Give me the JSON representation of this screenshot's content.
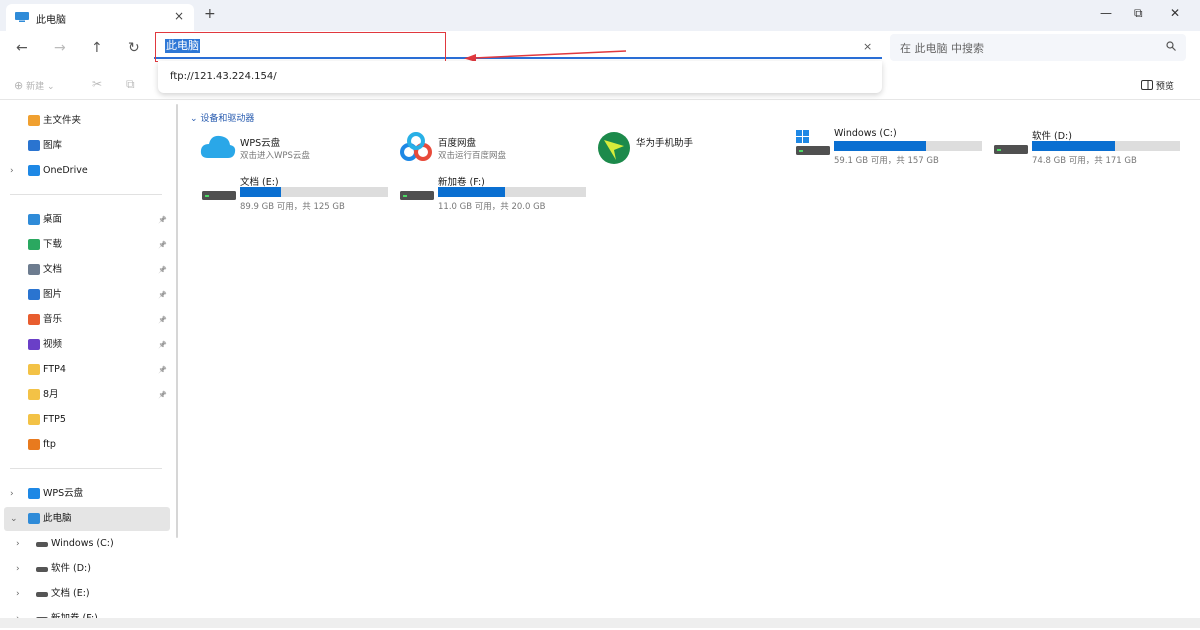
{
  "window": {
    "tab_title": "此电脑",
    "tab_close": "×",
    "new_tab": "+",
    "minimize": "—",
    "restore": "⧉",
    "close": "✕"
  },
  "nav": {
    "back": "←",
    "forward": "→",
    "up": "↑",
    "refresh": "↻"
  },
  "address": {
    "value": "此电脑",
    "clear": "×",
    "suggestion": "ftp://121.43.224.154/"
  },
  "search": {
    "placeholder": "在 此电脑 中搜索"
  },
  "toolbar": {
    "new_label": "新建",
    "new_arrow": "⌄",
    "cut": "✂",
    "copy": "⧉",
    "preview_label": "预览"
  },
  "sidebar": {
    "quick": [
      {
        "label": "主文件夹",
        "icon": "home-icon",
        "color": "#f0a030"
      },
      {
        "label": "图库",
        "icon": "gallery-icon",
        "color": "#2a74d0"
      },
      {
        "label": "OneDrive",
        "icon": "cloud-icon",
        "color": "#1e88e5",
        "chevron": "›"
      }
    ],
    "pinned": [
      {
        "label": "桌面",
        "icon": "desktop-icon",
        "color": "#2f8bd8"
      },
      {
        "label": "下载",
        "icon": "download-icon",
        "color": "#2aa860"
      },
      {
        "label": "文档",
        "icon": "document-icon",
        "color": "#6d7c8f"
      },
      {
        "label": "图片",
        "icon": "pictures-icon",
        "color": "#2a74d0"
      },
      {
        "label": "音乐",
        "icon": "music-icon",
        "color": "#e85d2f"
      },
      {
        "label": "视频",
        "icon": "video-icon",
        "color": "#6a3fc7"
      },
      {
        "label": "FTP4",
        "icon": "folder-icon",
        "color": "#f3c246"
      },
      {
        "label": "8月",
        "icon": "folder-icon",
        "color": "#f3c246"
      },
      {
        "label": "FTP5",
        "icon": "folder-icon",
        "color": "#f3c246"
      },
      {
        "label": "ftp",
        "icon": "ftp-folder-icon",
        "color": "#e87a1e"
      }
    ],
    "pin_glyph": "📌",
    "tree": [
      {
        "label": "WPS云盘",
        "chevron": "›",
        "icon": "wps-cloud-icon",
        "color": "#1e88e5"
      },
      {
        "label": "此电脑",
        "chevron": "⌄",
        "icon": "this-pc-icon",
        "color": "#2f8bd8"
      },
      {
        "label": "Windows (C:)",
        "chevron": "›",
        "icon": "drive-icon",
        "color": "#555"
      },
      {
        "label": "软件 (D:)",
        "chevron": "›",
        "icon": "drive-icon",
        "color": "#555"
      },
      {
        "label": "文档 (E:)",
        "chevron": "›",
        "icon": "drive-icon",
        "color": "#555"
      },
      {
        "label": "新加卷 (F:)",
        "chevron": "›",
        "icon": "drive-icon",
        "color": "#555"
      }
    ]
  },
  "main": {
    "section_title": "设备和驱动器",
    "section_chevron": "⌄",
    "apps": [
      {
        "title": "WPS云盘",
        "subtitle": "双击进入WPS云盘",
        "icon": "wps-cloud-icon"
      },
      {
        "title": "百度网盘",
        "subtitle": "双击运行百度网盘",
        "icon": "baidu-netdisk-icon"
      },
      {
        "title": "华为手机助手",
        "subtitle": "",
        "icon": "huawei-assistant-icon"
      }
    ],
    "drives": [
      {
        "title": "Windows (C:)",
        "info": "59.1 GB 可用，共 157 GB",
        "used_fraction": 0.62
      },
      {
        "title": "软件 (D:)",
        "info": "74.8 GB 可用，共 171 GB",
        "used_fraction": 0.56
      },
      {
        "title": "文档 (E:)",
        "info": "89.9 GB 可用，共 125 GB",
        "used_fraction": 0.28
      },
      {
        "title": "新加卷 (F:)",
        "info": "11.0 GB 可用，共 20.0 GB",
        "used_fraction": 0.45
      }
    ]
  },
  "colors": {
    "accent": "#0a6fd1",
    "highlight_box": "#e0383e"
  }
}
